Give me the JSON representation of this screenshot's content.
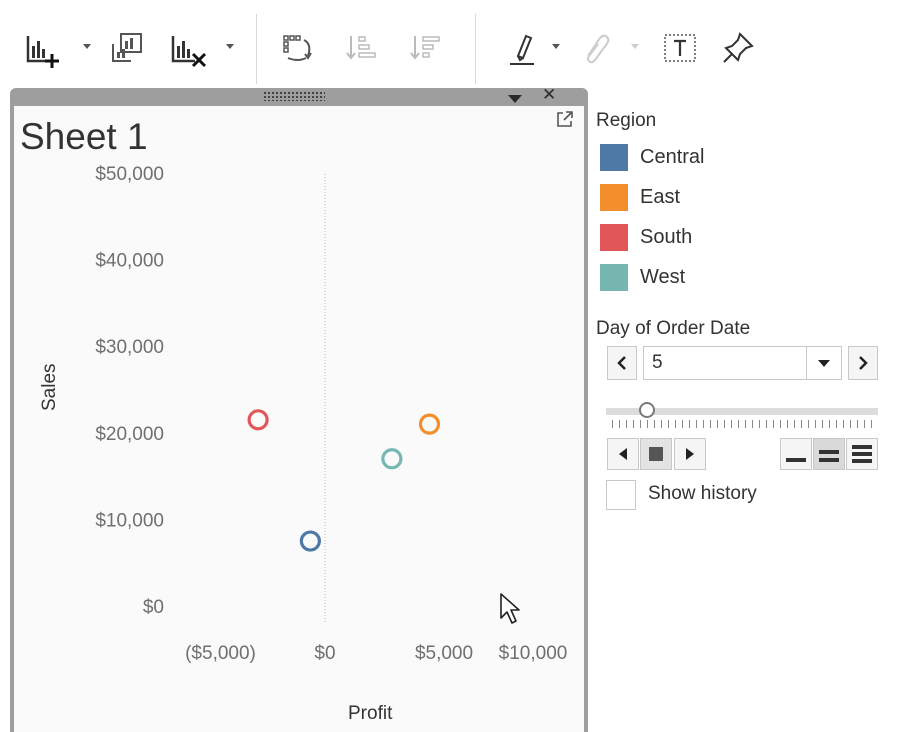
{
  "toolbar": {
    "icons": [
      "new-worksheet-icon",
      "duplicate-sheet-icon",
      "clear-sheet-icon",
      "swap-rows-columns-icon",
      "sort-ascending-icon",
      "sort-descending-icon",
      "highlight-icon",
      "group-members-icon",
      "show-mark-labels-icon",
      "fix-axes-icon"
    ]
  },
  "sheet": {
    "title": "Sheet 1"
  },
  "chart_data": {
    "type": "scatter",
    "xlabel": "Profit",
    "ylabel": "Sales",
    "x_ticks": [
      "($5,000)",
      "$0",
      "$5,000",
      "$10,000"
    ],
    "y_ticks": [
      "$0",
      "$10,000",
      "$20,000",
      "$30,000",
      "$40,000",
      "$50,000"
    ],
    "xlim": [
      -9000,
      13000
    ],
    "ylim": [
      0,
      50000
    ],
    "series": [
      {
        "name": "Central",
        "color": "#4e79a7",
        "points": [
          {
            "x": -700,
            "y": 7500
          }
        ]
      },
      {
        "name": "East",
        "color": "#f28e2b",
        "points": [
          {
            "x": 5000,
            "y": 21000
          }
        ]
      },
      {
        "name": "South",
        "color": "#e15759",
        "points": [
          {
            "x": -3200,
            "y": 21500
          }
        ]
      },
      {
        "name": "West",
        "color": "#76b7b2",
        "points": [
          {
            "x": 3200,
            "y": 17000
          }
        ]
      }
    ]
  },
  "legend": {
    "title": "Region",
    "items": [
      {
        "label": "Central",
        "color": "#4e79a7"
      },
      {
        "label": "East",
        "color": "#f28e2b"
      },
      {
        "label": "South",
        "color": "#e15759"
      },
      {
        "label": "West",
        "color": "#76b7b2"
      }
    ]
  },
  "page_control": {
    "title": "Day of Order Date",
    "value": "5",
    "show_history_label": "Show history",
    "show_history_checked": false,
    "slider_position": 0.15
  }
}
